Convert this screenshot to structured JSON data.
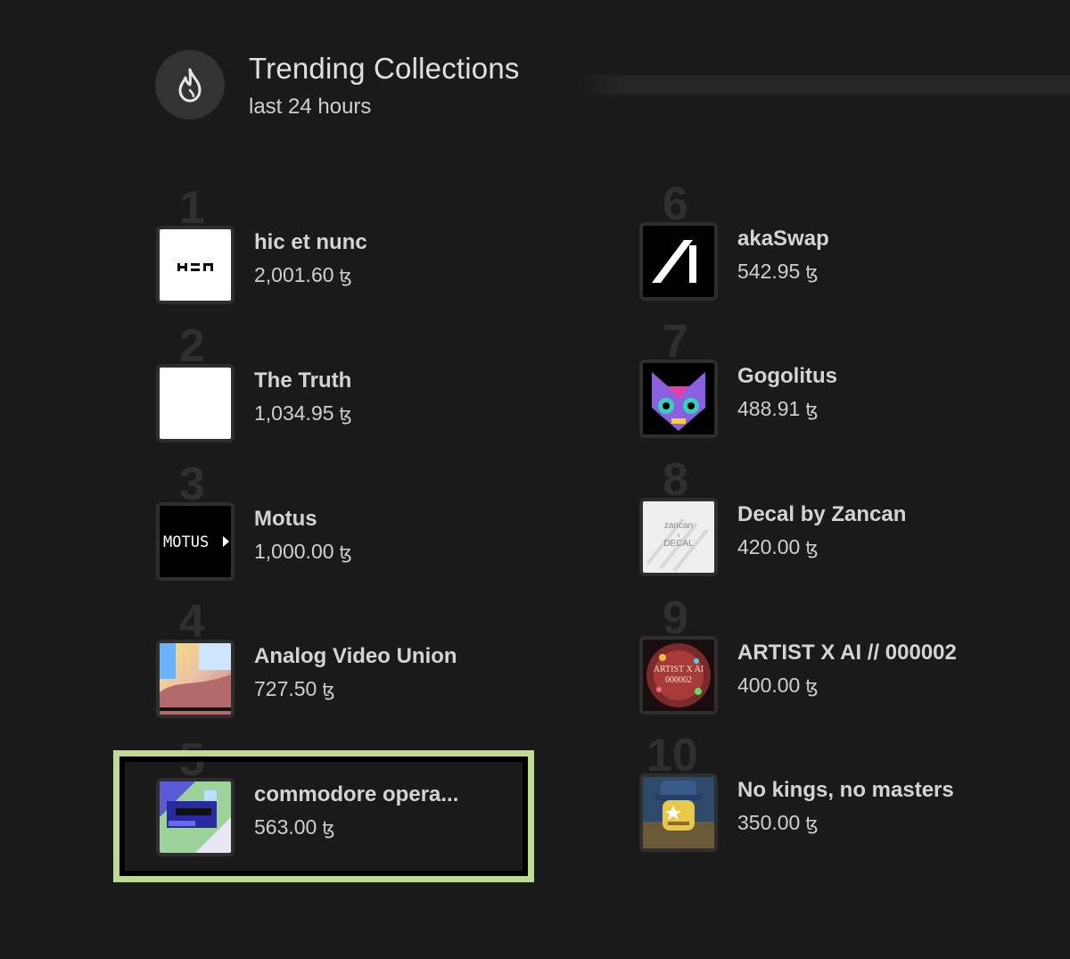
{
  "header": {
    "title": "Trending Collections",
    "subtitle": "last 24 hours",
    "icon": "flame-icon"
  },
  "collections": [
    {
      "rank": "1",
      "name": "hic et nunc",
      "price": "2,001.60",
      "currency": "ꜩ",
      "thumb": "hen-logo"
    },
    {
      "rank": "2",
      "name": "The Truth",
      "price": "1,034.95",
      "currency": "ꜩ",
      "thumb": "blank-white"
    },
    {
      "rank": "3",
      "name": "Motus",
      "price": "1,000.00",
      "currency": "ꜩ",
      "thumb": "motus-logo",
      "thumb_text": "MOTUS"
    },
    {
      "rank": "4",
      "name": "Analog Video Union",
      "price": "727.50",
      "currency": "ꜩ",
      "thumb": "analog-video-art"
    },
    {
      "rank": "5",
      "name": "commodore opera...",
      "price": "563.00",
      "currency": "ꜩ",
      "thumb": "glitch-art",
      "highlighted": true
    },
    {
      "rank": "6",
      "name": "akaSwap",
      "price": "542.95",
      "currency": "ꜩ",
      "thumb": "akaswap-logo"
    },
    {
      "rank": "7",
      "name": "Gogolitus",
      "price": "488.91",
      "currency": "ꜩ",
      "thumb": "cat-skull-art"
    },
    {
      "rank": "8",
      "name": "Decal by Zancan",
      "price": "420.00",
      "currency": "ꜩ",
      "thumb": "decal-logo",
      "thumb_text": [
        "zancan",
        "x",
        "DECAL"
      ]
    },
    {
      "rank": "9",
      "name": "ARTIST X AI // 000002",
      "price": "400.00",
      "currency": "ꜩ",
      "thumb": "artist-ai-art",
      "thumb_text": [
        "ARTIST X AI",
        "000002"
      ]
    },
    {
      "rank": "10",
      "name": "No kings, no masters",
      "price": "350.00",
      "currency": "ꜩ",
      "thumb": "masked-figure-art"
    }
  ],
  "colors": {
    "background": "#1a1a1a",
    "highlight": "#bddb92",
    "badge": "#333333"
  }
}
